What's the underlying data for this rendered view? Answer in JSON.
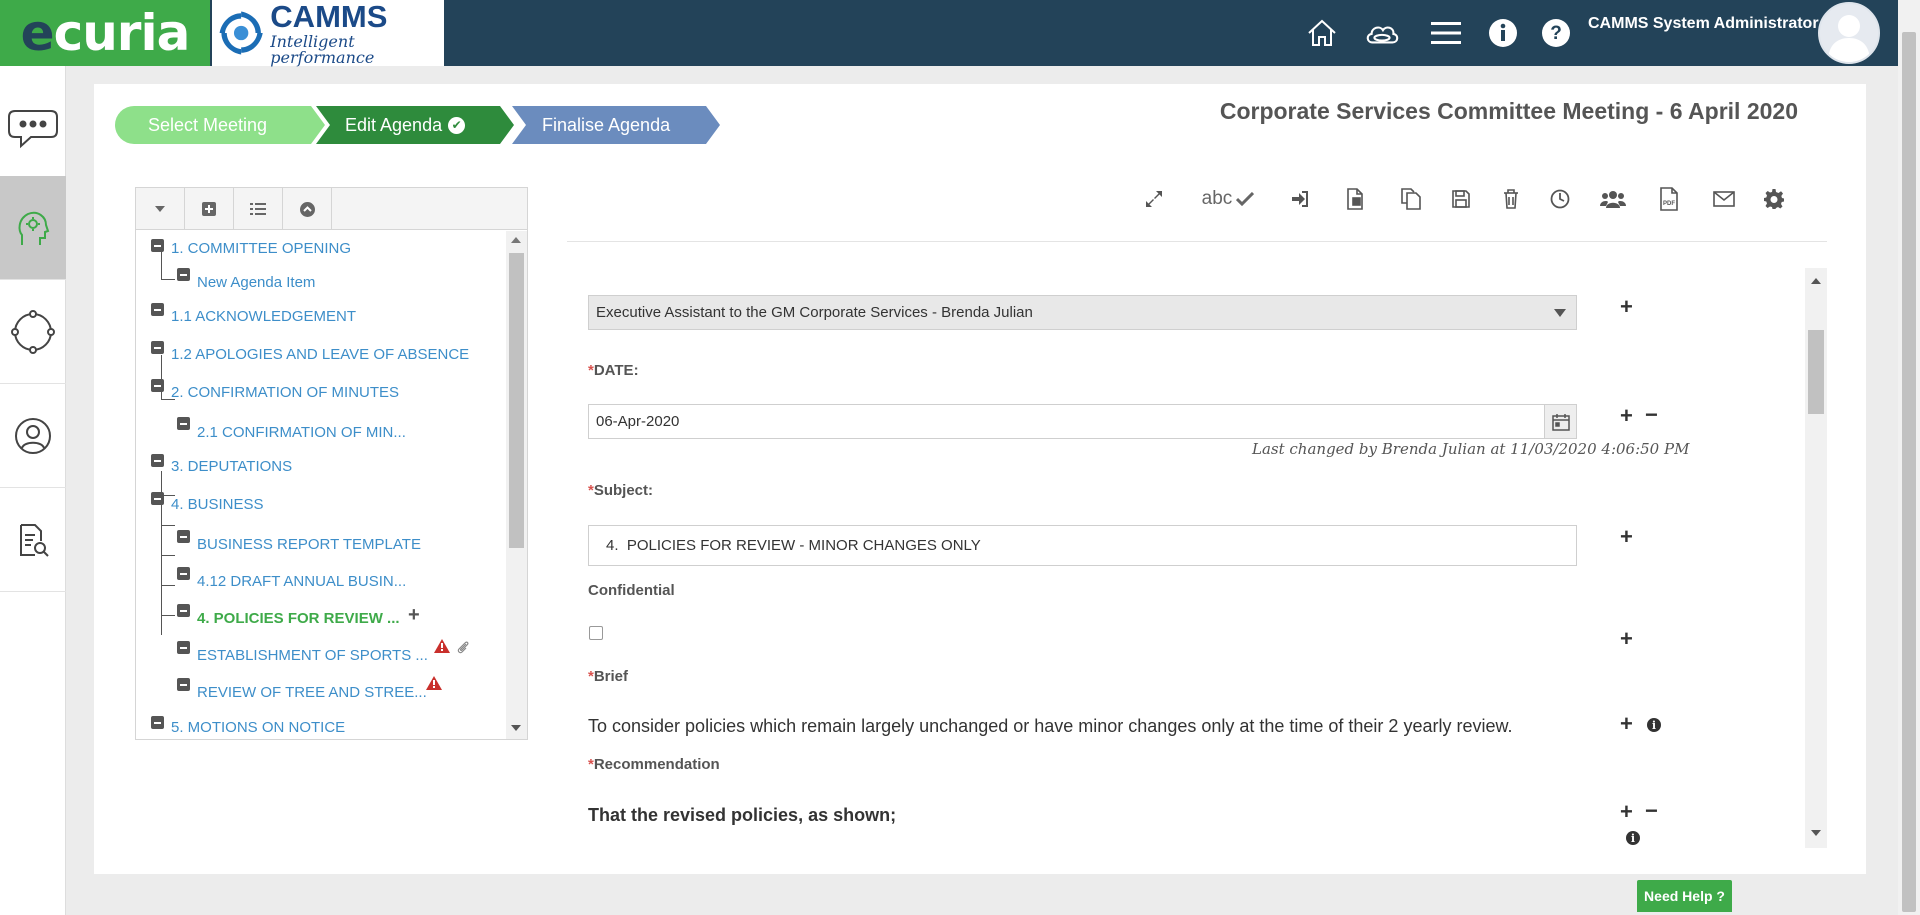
{
  "brand": {
    "ecuria_first": "e",
    "ecuria_rest": "curia",
    "camms_name": "CAMMS",
    "camms_tagline": "Intelligent performance"
  },
  "header": {
    "icons": [
      "home-icon",
      "cloud-icon",
      "menu-icon",
      "info-icon",
      "help-icon"
    ],
    "user_name": "CAMMS System Administrator"
  },
  "sidebar": {
    "items": [
      "chat-icon",
      "meeting-settings-icon",
      "cycle-icon",
      "user-icon",
      "document-search-icon"
    ],
    "active_index": 1
  },
  "wizard": {
    "steps": [
      {
        "label": "Select Meeting",
        "state": "done"
      },
      {
        "label": "Edit Agenda",
        "state": "current",
        "check": "✔"
      },
      {
        "label": "Finalise Agenda",
        "state": "next"
      }
    ],
    "colors": {
      "done": "#8ee08a",
      "current": "#2e8b3c",
      "next": "#6b8cbe"
    }
  },
  "meeting_title": "Corporate Services Committee Meeting - 6 April 2020",
  "tree": {
    "toolbar": [
      "caret-down-icon",
      "plus-square-icon",
      "list-icon",
      "chevron-up-circle-icon"
    ],
    "nodes": [
      {
        "label": "1. COMMITTEE OPENING",
        "level": 0
      },
      {
        "label": "New Agenda Item",
        "level": 1
      },
      {
        "label": "1.1 ACKNOWLEDGEMENT",
        "level": 0
      },
      {
        "label": "1.2 APOLOGIES AND LEAVE OF ABSENCE",
        "level": 0
      },
      {
        "label": "2. CONFIRMATION OF MINUTES",
        "level": 0
      },
      {
        "label": "2.1 CONFIRMATION OF MIN...",
        "level": 1
      },
      {
        "label": "3. DEPUTATIONS",
        "level": 0
      },
      {
        "label": "4. BUSINESS",
        "level": 0
      },
      {
        "label": "BUSINESS REPORT TEMPLATE",
        "level": 1
      },
      {
        "label": "4.12 DRAFT ANNUAL BUSIN...",
        "level": 1
      },
      {
        "label": "4. POLICIES FOR REVIEW ...",
        "level": 1,
        "active": true
      },
      {
        "label": "ESTABLISHMENT OF SPORTS ...",
        "level": 1,
        "warning": true,
        "attachment": true
      },
      {
        "label": "REVIEW OF TREE AND STREE...",
        "level": 1,
        "warning": true
      },
      {
        "label": "5. MOTIONS ON NOTICE",
        "level": 0
      }
    ],
    "add_symbol": "+"
  },
  "content_toolbar": {
    "spellcheck_label": "abc",
    "icons": [
      "expand-icon",
      "spellcheck-icon",
      "sign-in-icon",
      "report-icon",
      "copy-icon",
      "save-icon",
      "trash-icon",
      "clock-icon",
      "users-icon",
      "pdf-icon",
      "envelope-icon",
      "gear-icon"
    ]
  },
  "form": {
    "author_select": "Executive Assistant to the GM Corporate Services - Brenda Julian",
    "required_mark": "*",
    "date_label": "DATE:",
    "date_value": "06-Apr-2020",
    "last_changed": "Last changed by Brenda Julian at 11/03/2020 4:06:50 PM",
    "subject_label": "Subject:",
    "subject_value": "4.  POLICIES FOR REVIEW - MINOR CHANGES ONLY",
    "confidential_label": "Confidential",
    "confidential_checked": false,
    "brief_label": "Brief",
    "brief_text": "To consider policies which remain largely unchanged or have minor changes only at the time of their 2 yearly review.",
    "recommendation_label": "Recommendation",
    "recommendation_text": "That the revised policies, as shown;",
    "plus": "+",
    "minus": "−",
    "info": "i"
  },
  "help_button": "Need Help ?"
}
